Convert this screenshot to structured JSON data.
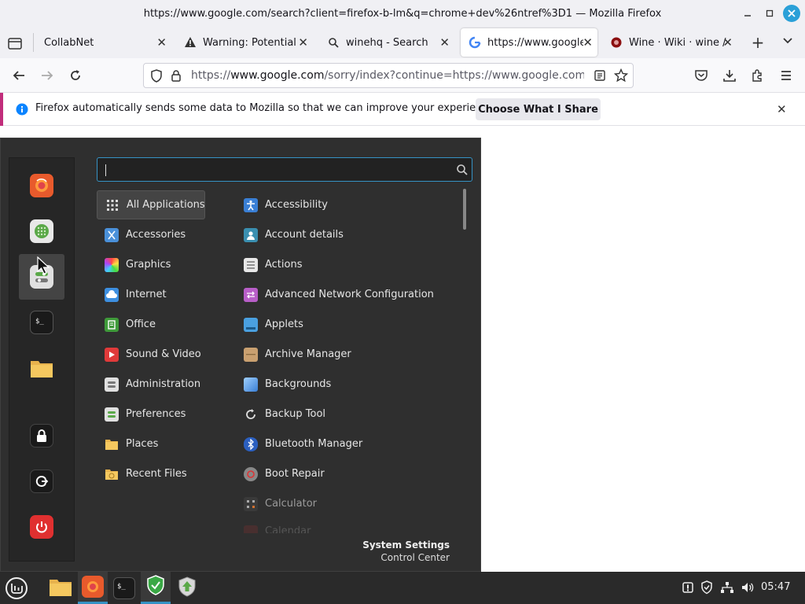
{
  "window": {
    "title": "https://www.google.com/search?client=firefox-b-lm&q=chrome+dev%26ntref%3D1 — Mozilla Firefox"
  },
  "tabs": [
    {
      "label": "CollabNet",
      "icon": "blank-page-icon",
      "active": false
    },
    {
      "label": "Warning: Potential S",
      "icon": "warning-icon",
      "active": false
    },
    {
      "label": "winehq - Search",
      "icon": "search-icon",
      "active": false
    },
    {
      "label": "https://www.google",
      "icon": "google-icon",
      "active": true
    },
    {
      "label": "Wine · Wiki · wine / w",
      "icon": "wine-icon",
      "active": false
    }
  ],
  "urlbar": {
    "prefix": "https://",
    "host": "www.google.com",
    "path": "/sorry/index?continue=https://www.google.com/sear"
  },
  "notification": {
    "text": "Firefox automatically sends some data to Mozilla so that we can improve your experience.",
    "button": "Choose What I Share",
    "accent_color": "#c12d7b"
  },
  "menu": {
    "search": {
      "value": "",
      "placeholder": ""
    },
    "favorites": [
      {
        "name": "firefox",
        "icon": "firefox-icon"
      },
      {
        "name": "software-manager",
        "icon": "software-manager-icon"
      },
      {
        "name": "settings",
        "icon": "settings-icon"
      },
      {
        "name": "terminal",
        "icon": "terminal-icon"
      },
      {
        "name": "files",
        "icon": "folder-icon"
      },
      {
        "name": "lock-screen",
        "icon": "lock-icon"
      },
      {
        "name": "logout",
        "icon": "logout-icon"
      },
      {
        "name": "shutdown",
        "icon": "power-icon"
      }
    ],
    "categories": [
      {
        "label": "All Applications",
        "icon": "grid-icon",
        "selected": true
      },
      {
        "label": "Accessories",
        "icon": "accessories-icon"
      },
      {
        "label": "Graphics",
        "icon": "graphics-icon"
      },
      {
        "label": "Internet",
        "icon": "cloud-icon"
      },
      {
        "label": "Office",
        "icon": "office-icon"
      },
      {
        "label": "Sound & Video",
        "icon": "play-icon"
      },
      {
        "label": "Administration",
        "icon": "administration-icon"
      },
      {
        "label": "Preferences",
        "icon": "preferences-icon"
      },
      {
        "label": "Places",
        "icon": "folder-icon"
      },
      {
        "label": "Recent Files",
        "icon": "recent-folder-icon"
      }
    ],
    "apps": [
      {
        "label": "Accessibility",
        "icon": "accessibility-icon"
      },
      {
        "label": "Account details",
        "icon": "account-icon"
      },
      {
        "label": "Actions",
        "icon": "actions-icon"
      },
      {
        "label": "Advanced Network Configuration",
        "icon": "network-config-icon"
      },
      {
        "label": "Applets",
        "icon": "applets-icon"
      },
      {
        "label": "Archive Manager",
        "icon": "archive-icon"
      },
      {
        "label": "Backgrounds",
        "icon": "backgrounds-icon"
      },
      {
        "label": "Backup Tool",
        "icon": "backup-icon"
      },
      {
        "label": "Bluetooth Manager",
        "icon": "bluetooth-icon"
      },
      {
        "label": "Boot Repair",
        "icon": "boot-repair-icon"
      },
      {
        "label": "Calculator",
        "icon": "calculator-icon"
      },
      {
        "label": "Calendar",
        "icon": "calendar-icon"
      }
    ],
    "system": {
      "title": "System Settings",
      "subtitle": "Control Center"
    }
  },
  "taskbar": {
    "apps": [
      {
        "name": "files",
        "icon": "folder-icon",
        "active": false
      },
      {
        "name": "firefox",
        "icon": "firefox-icon",
        "active": true
      },
      {
        "name": "terminal",
        "icon": "terminal-icon",
        "active": false
      },
      {
        "name": "update-manager",
        "icon": "shield-icon",
        "active": true
      },
      {
        "name": "software-manager",
        "icon": "update-icon",
        "active": false
      }
    ],
    "clock": "05:47"
  }
}
